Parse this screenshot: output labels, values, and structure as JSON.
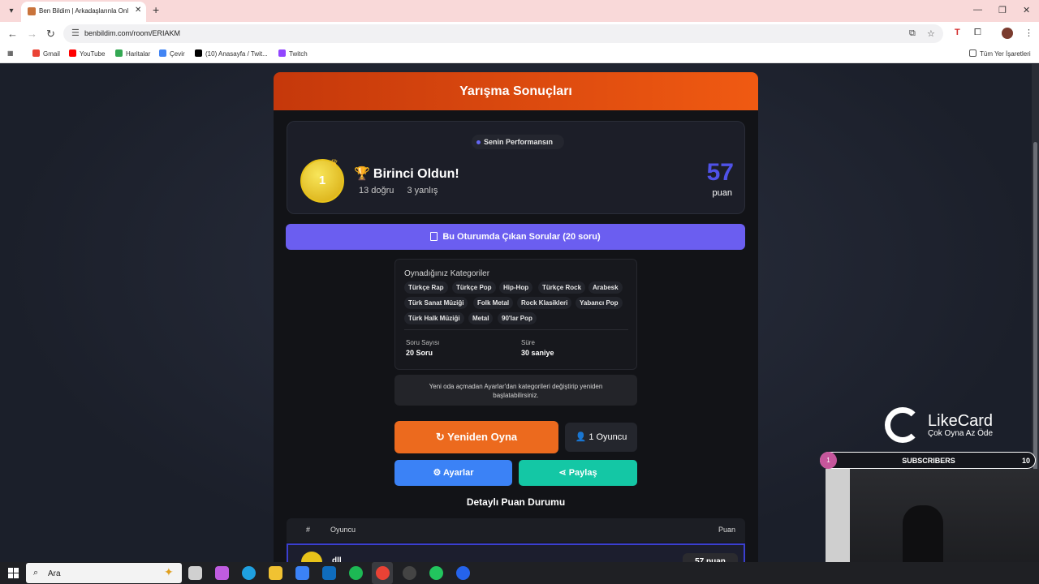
{
  "browser": {
    "tab_title": "Ben Bildim | Arkadaşlarınla Onl",
    "url": "benbildim.com/room/ERIAKM",
    "bookmarks": [
      {
        "label": "Gmail",
        "color": "#ea4335"
      },
      {
        "label": "YouTube",
        "color": "#ff0000"
      },
      {
        "label": "Haritalar",
        "color": "#34a853"
      },
      {
        "label": "Çevir",
        "color": "#4285f4"
      },
      {
        "label": "(10) Anasayfa / Twit...",
        "color": "#000000"
      },
      {
        "label": "Twitch",
        "color": "#9146ff"
      }
    ],
    "all_bookmarks": "Tüm Yer İşaretleri"
  },
  "results": {
    "header": "Yarışma Sonuçları",
    "performance_pill": "Senin Performansın",
    "rank": "1",
    "title": "Birinci Oldun!",
    "correct": "13 doğru",
    "wrong": "3 yanlış",
    "score": "57",
    "score_label": "puan",
    "questions_button": "Bu Oturumda Çıkan Sorular (20 soru)",
    "categories_title": "Oynadığınız Kategoriler",
    "categories": [
      "Türkçe Rap",
      "Türkçe Pop",
      "Hip-Hop",
      "Türkçe Rock",
      "Arabesk",
      "Türk Sanat Müziği",
      "Folk Metal",
      "Rock Klasikleri",
      "Yabancı Pop",
      "Türk Halk Müziği",
      "Metal",
      "90'lar Pop"
    ],
    "question_count_label": "Soru Sayısı",
    "question_count": "20 Soru",
    "duration_label": "Süre",
    "duration": "30 saniye",
    "note": "Yeni oda açmadan Ayarlar'dan kategorileri değiştirip yeniden başlatabilirsiniz.",
    "replay_button": "Yeniden Oyna",
    "players_button": "1 Oyuncu",
    "settings_button": "Ayarlar",
    "share_button": "Paylaş",
    "detail_title": "Detaylı Puan Durumu",
    "table_headers": {
      "rank": "#",
      "player": "Oyuncu",
      "points": "Puan"
    },
    "rows": [
      {
        "rank": "1",
        "name": "dll",
        "points": "57 puan"
      }
    ]
  },
  "overlay": {
    "brand": "LikeCard",
    "slogan": "Çok Oyna  Az Öde",
    "subscribers_label": "SUBSCRIBERS",
    "subscribers_count": "10",
    "subscribers_index": "1"
  },
  "taskbar": {
    "search_placeholder": "Ara",
    "apps": [
      {
        "name": "task-view",
        "color": "#d0d0d0"
      },
      {
        "name": "copilot",
        "color": "#c05ce0"
      },
      {
        "name": "edge",
        "color": "#1fa0e0"
      },
      {
        "name": "file-explorer",
        "color": "#f1c232"
      },
      {
        "name": "store",
        "color": "#3b82f6"
      },
      {
        "name": "outlook",
        "color": "#0f6cbd"
      },
      {
        "name": "spotify",
        "color": "#1db954"
      },
      {
        "name": "chrome",
        "color": "#e94235"
      },
      {
        "name": "obs",
        "color": "#444444"
      },
      {
        "name": "app-green",
        "color": "#22c55e"
      },
      {
        "name": "app-blue",
        "color": "#2563eb"
      }
    ]
  },
  "colors": {
    "accent_orange": "#ec6a1e",
    "accent_purple": "#6b5ef0",
    "score_blue": "#4f52e8",
    "share_teal": "#14c7a5",
    "settings_blue": "#3b82f6"
  }
}
